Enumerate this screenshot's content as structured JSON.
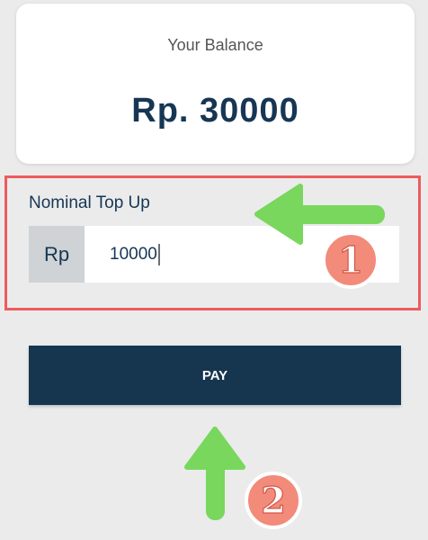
{
  "balance": {
    "label": "Your Balance",
    "amount": "Rp. 30000"
  },
  "topup": {
    "label": "Nominal Top Up",
    "currency": "Rp",
    "value": "10000"
  },
  "pay_button": {
    "label": "PAY"
  },
  "annotations": {
    "step1": "1",
    "step2": "2"
  },
  "colors": {
    "background": "#ebebeb",
    "primary": "#16354f",
    "highlight": "#ee5a5f",
    "arrow": "#78d75c",
    "badge": "#f28b7a"
  },
  "icons": {
    "arrow_left": "left-arrow-icon",
    "arrow_up": "up-arrow-icon"
  }
}
